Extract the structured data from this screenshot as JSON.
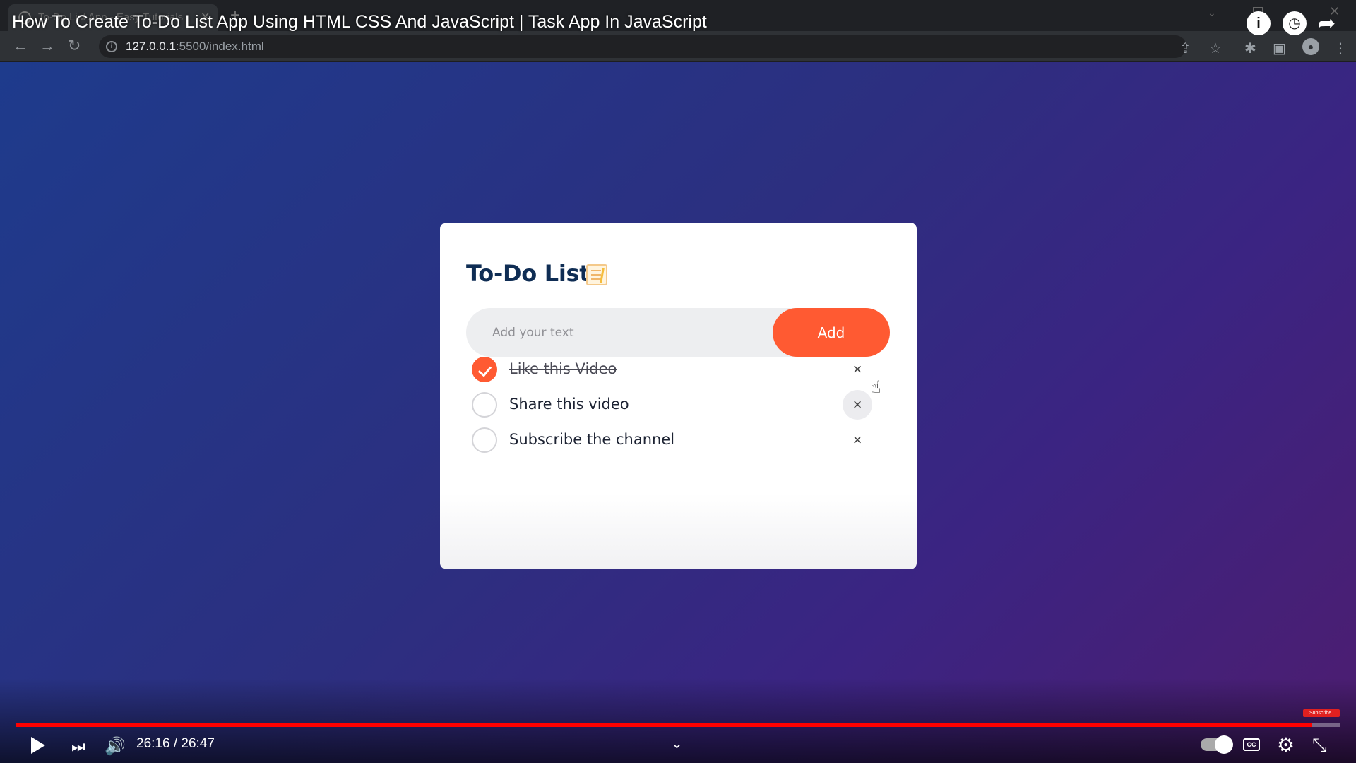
{
  "video": {
    "title": "How To Create To-Do List App Using HTML CSS And JavaScript | Task App In JavaScript",
    "time_display": "26:16 / 26:47",
    "progress_percent": 97.8,
    "subscribe_badge": "Subscribe",
    "icons": [
      "info-icon",
      "watch-later-icon",
      "share-icon",
      "play-icon",
      "next-icon",
      "volume-icon",
      "chevron-down-icon",
      "autoplay-toggle",
      "cc-icon",
      "gear-icon",
      "exit-fullscreen-icon"
    ]
  },
  "browser": {
    "tab_title": "To-Do List App - Easy Tutorials",
    "url_host": "127.0.0.1",
    "url_rest": ":5500/index.html",
    "nav_icons": [
      "back-icon",
      "forward-icon",
      "reload-icon"
    ],
    "toolbar_icons": [
      "share-page-icon",
      "star-icon",
      "extensions-icon",
      "sidebar-icon",
      "profile-icon",
      "menu-icon"
    ]
  },
  "app": {
    "title": "To-Do List",
    "input_placeholder": "Add your text",
    "add_label": "Add",
    "accent_color": "#ff5a32",
    "title_color": "#0f2d54",
    "todos": [
      {
        "label": "Like this Video",
        "checked": true
      },
      {
        "label": "Share this video",
        "checked": false
      },
      {
        "label": "Subscribe the channel",
        "checked": false
      }
    ]
  }
}
